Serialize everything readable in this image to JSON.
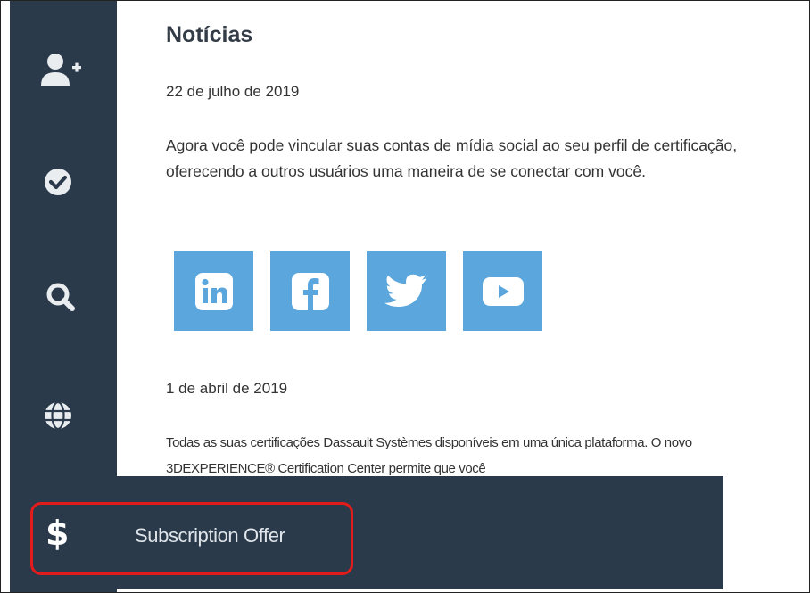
{
  "sidebar": {
    "icons": [
      "add-user-icon",
      "check-circle-icon",
      "search-icon",
      "globe-icon",
      "dollar-icon"
    ]
  },
  "news": {
    "title": "Notícias",
    "items": [
      {
        "date": "22 de julho de 2019",
        "text": "Agora você pode vincular suas contas de mídia social ao seu perfil de certificação, oferecendo a outros usuários uma maneira de se conectar com você."
      },
      {
        "date": "1 de abril de 2019",
        "text": "Todas as suas certificações Dassault Systèmes disponíveis em uma única plataforma. O novo 3DEXPERIENCE® Certification Center permite que você"
      }
    ],
    "social": [
      "linkedin-icon",
      "facebook-icon",
      "twitter-icon",
      "youtube-icon"
    ]
  },
  "subscription": {
    "symbol": "$",
    "label": "Subscription Offer"
  },
  "colors": {
    "sidebar_bg": "#2b3a4a",
    "social_bg": "#5aa6dd",
    "highlight": "#e21b1b"
  }
}
